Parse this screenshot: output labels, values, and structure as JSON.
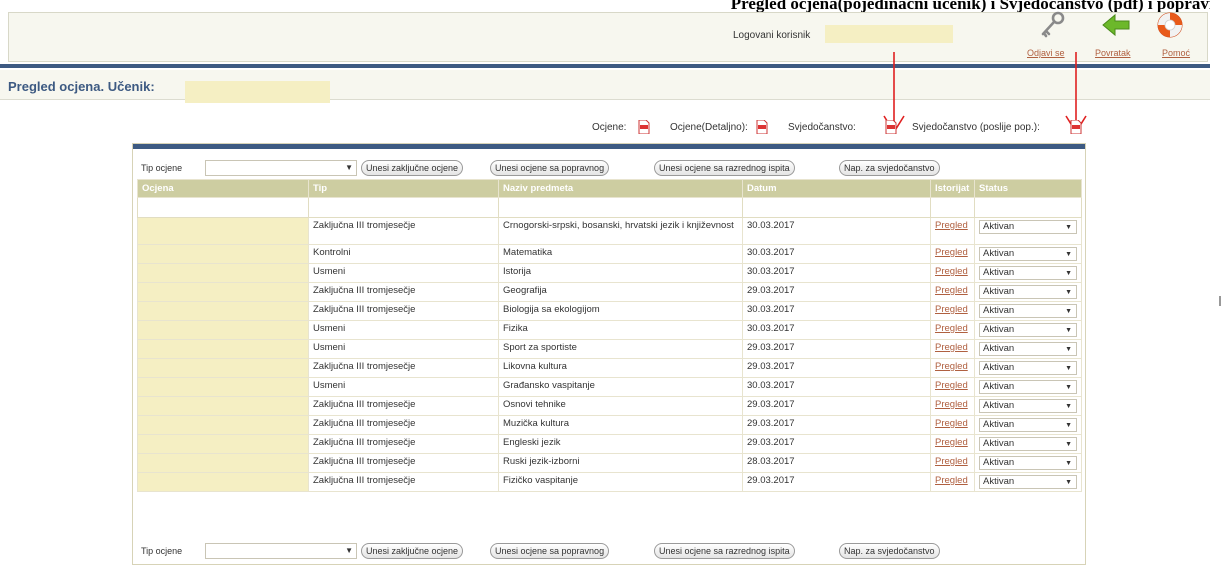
{
  "top_caption": "Pregled ocjena(pojedinačni učenik) i Svjedočanstvo (pdf) i popravni",
  "header": {
    "user_label": "Logovani korisnik",
    "links": {
      "logout": "Odjavi se",
      "back": "Povratak",
      "help": "Pomoć"
    }
  },
  "page": {
    "title": "Pregled ocjena. Učenik:"
  },
  "reports": {
    "grades": "Ocjene:",
    "grades_detailed": "Ocjene(Detaljno):",
    "certificate": "Svjedočanstvo:",
    "certificate_after": "Svjedočanstvo (poslije pop.):"
  },
  "filter": {
    "label": "Tip ocjene",
    "buttons": [
      "Unesi zaključne ocjene",
      "Unesi ocjene sa popravnog",
      "Unesi ocjene sa razrednog ispita",
      "Nap. za svjedočanstvo"
    ]
  },
  "table": {
    "columns": [
      "Ocjena",
      "Tip",
      "Naziv predmeta",
      "Datum",
      "Istorijat",
      "Status"
    ],
    "history_link": "Pregled",
    "rows": [
      {
        "tip": "Zaključna III tromjesečje",
        "predmet": "Crnogorski-srpski, bosanski, hrvatski jezik i književnost",
        "datum": "30.03.2017",
        "status": "Aktivan"
      },
      {
        "tip": "Kontrolni",
        "predmet": "Matematika",
        "datum": "30.03.2017",
        "status": "Aktivan"
      },
      {
        "tip": "Usmeni",
        "predmet": "Istorija",
        "datum": "30.03.2017",
        "status": "Aktivan"
      },
      {
        "tip": "Zaključna III tromjesečje",
        "predmet": "Geografija",
        "datum": "29.03.2017",
        "status": "Aktivan"
      },
      {
        "tip": "Zaključna III tromjesečje",
        "predmet": "Biologija sa ekologijom",
        "datum": "30.03.2017",
        "status": "Aktivan"
      },
      {
        "tip": "Usmeni",
        "predmet": "Fizika",
        "datum": "30.03.2017",
        "status": "Aktivan"
      },
      {
        "tip": "Usmeni",
        "predmet": "Sport za sportiste",
        "datum": "29.03.2017",
        "status": "Aktivan"
      },
      {
        "tip": "Zaključna III tromjesečje",
        "predmet": "Likovna kultura",
        "datum": "29.03.2017",
        "status": "Aktivan"
      },
      {
        "tip": "Usmeni",
        "predmet": "Građansko vaspitanje",
        "datum": "30.03.2017",
        "status": "Aktivan"
      },
      {
        "tip": "Zaključna III tromjesečje",
        "predmet": "Osnovi tehnike",
        "datum": "29.03.2017",
        "status": "Aktivan"
      },
      {
        "tip": "Zaključna III tromjesečje",
        "predmet": "Muzička kultura",
        "datum": "29.03.2017",
        "status": "Aktivan"
      },
      {
        "tip": "Zaključna III tromjesečje",
        "predmet": "Engleski jezik",
        "datum": "29.03.2017",
        "status": "Aktivan"
      },
      {
        "tip": "Zaključna III tromjesečje",
        "predmet": "Ruski jezik-izborni",
        "datum": "28.03.2017",
        "status": "Aktivan"
      },
      {
        "tip": "Zaključna III tromjesečje",
        "predmet": "Fizičko vaspitanje",
        "datum": "29.03.2017",
        "status": "Aktivan"
      }
    ]
  },
  "colors": {
    "brand_blue": "#3d5a82",
    "header_olive": "#cdcda1",
    "highlight_yellow": "#f5efc3",
    "link_brown": "#b06040",
    "arrow_red": "#e02020"
  },
  "icons": [
    "key-icon",
    "green-back-arrow-icon",
    "lifebuoy-icon",
    "pdf-icon",
    "red-arrow-annotation"
  ]
}
